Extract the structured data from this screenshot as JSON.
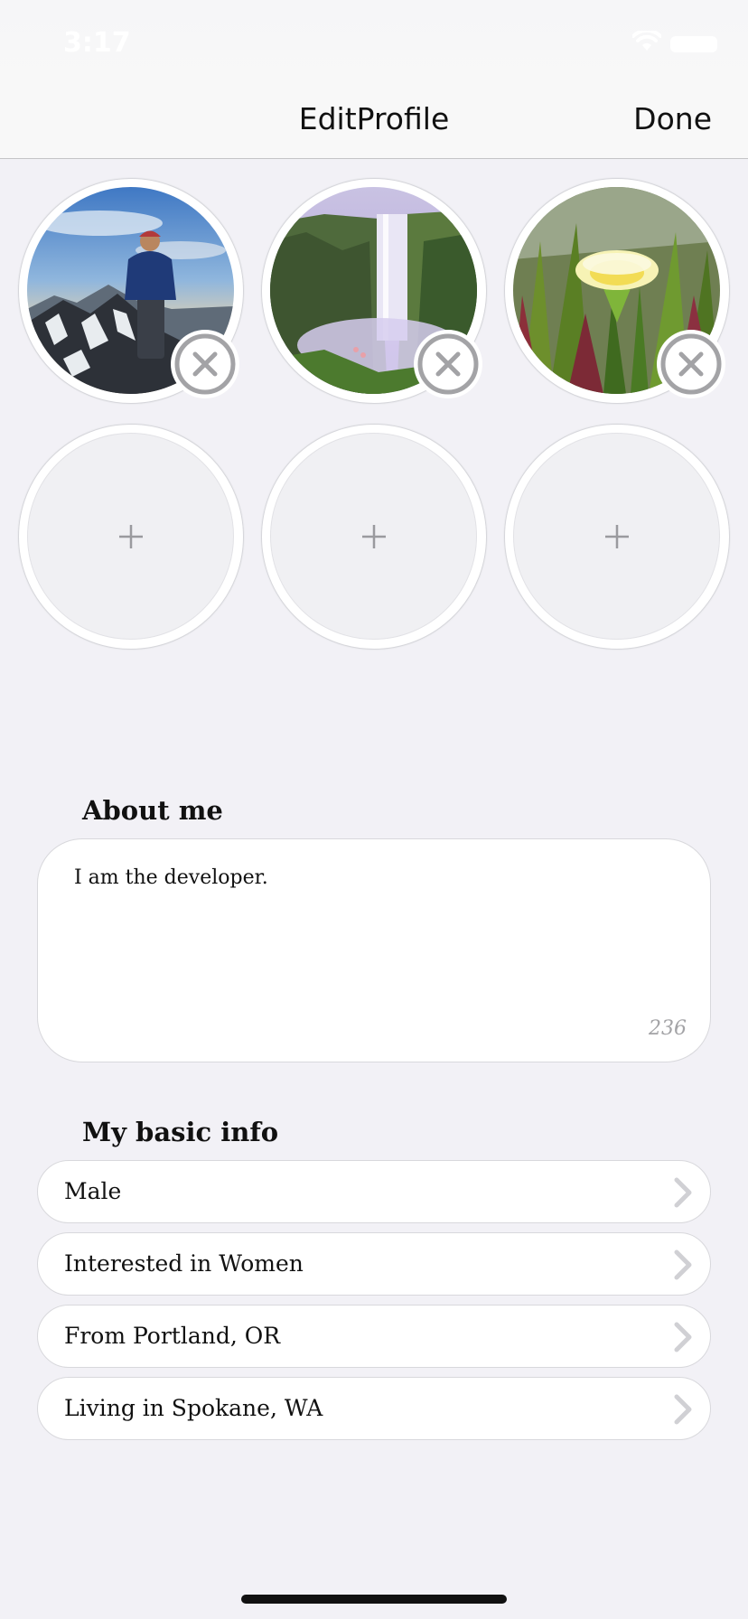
{
  "status_bar": {
    "time": "3:17"
  },
  "nav": {
    "title": "EditProfile",
    "done_label": "Done"
  },
  "photos": [
    {
      "subject": "hiker on mountain summit"
    },
    {
      "subject": "waterfall"
    },
    {
      "subject": "yellow ice plant flower"
    }
  ],
  "empty_slots": 3,
  "about": {
    "title": "About me",
    "text": "I am the developer.",
    "remaining_chars": "236"
  },
  "basic_info": {
    "title": "My basic info",
    "items": [
      {
        "label": "Male"
      },
      {
        "label": "Interested in Women"
      },
      {
        "label": "From Portland, OR"
      },
      {
        "label": "Living in Spokane, WA"
      }
    ]
  },
  "colors": {
    "background": "#f2f1f6",
    "remove_icon": "#a3a3a6",
    "chevron": "#d0d0d4"
  }
}
